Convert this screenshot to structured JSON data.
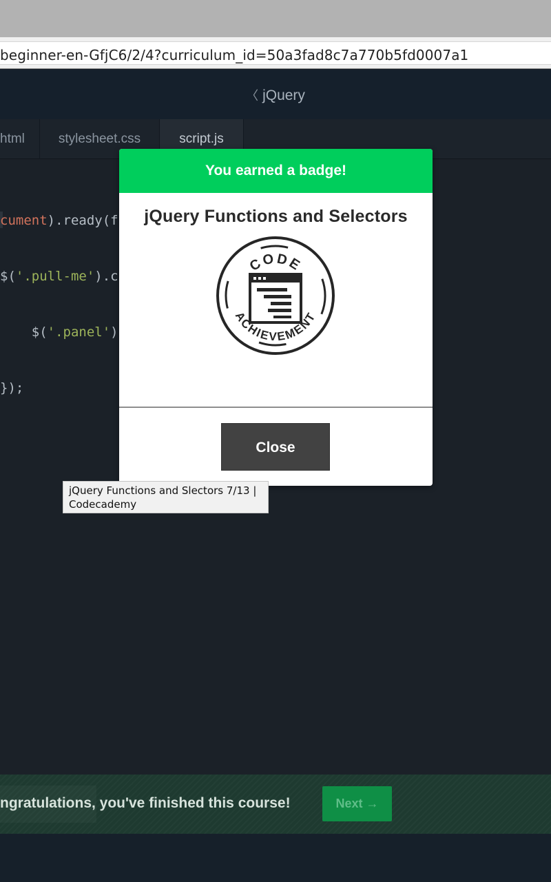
{
  "browser": {
    "url": "beginner-en-GfjC6/2/4?curriculum_id=50a3fad8c7a770b5fd0007a1"
  },
  "header": {
    "back_chevron": "〈",
    "title": "jQuery"
  },
  "tabs": [
    {
      "label": "html"
    },
    {
      "label": "stylesheet.css"
    },
    {
      "label": "script.js"
    }
  ],
  "editor": {
    "line1_a": "cument",
    "line1_b": ").ready(",
    "line1_c": "f",
    "line2_a": "$(",
    "line2_b": "'.pull-me'",
    "line2_c": ").c",
    "line3_a": "    $(",
    "line3_b": "'.panel'",
    "line3_c": ")",
    "line4": "});"
  },
  "modal": {
    "header": "You earned a badge!",
    "title": "jQuery Functions and Selectors",
    "badge_top_text": "CODE",
    "badge_bottom_text": "ACHIEVEMENT",
    "close_label": "Close"
  },
  "tooltip": {
    "text_line1": "jQuery Functions and Slectors 7/13 |",
    "text_line2": "Codecademy"
  },
  "footer": {
    "message": "ngratulations, you've finished this course!",
    "next_label": "Next →"
  },
  "colors": {
    "accent_green": "#00ce5c",
    "next_button": "#0f8f46",
    "close_button": "#424242"
  }
}
